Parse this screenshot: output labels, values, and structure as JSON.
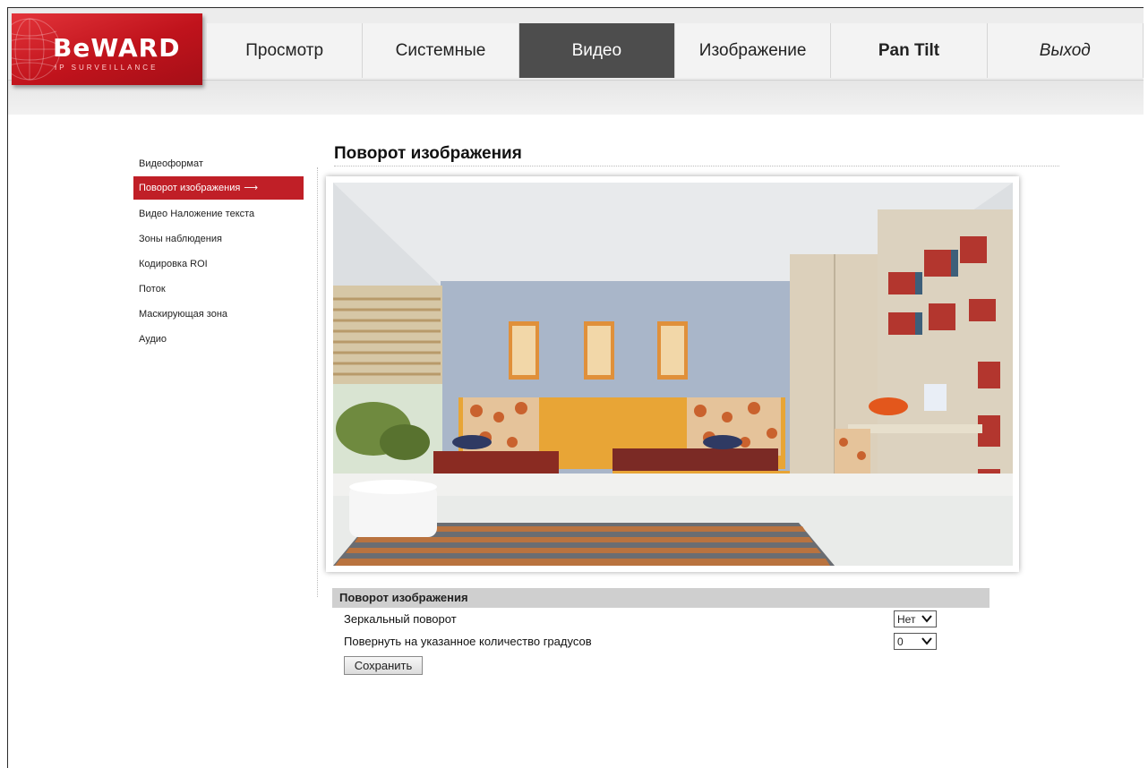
{
  "brand": {
    "name": "BeWARD",
    "tagline": "IP SURVEILLANCE"
  },
  "nav": {
    "tabs": [
      {
        "label": "Просмотр"
      },
      {
        "label": "Системные"
      },
      {
        "label": "Видео"
      },
      {
        "label": "Изображение"
      },
      {
        "label": "Pan Tilt"
      },
      {
        "label": "Выход"
      }
    ],
    "active": "Видео"
  },
  "sidebar": {
    "items": [
      {
        "label": "Видеоформат"
      },
      {
        "label": "Поворот изображения"
      },
      {
        "label": "Видео Наложение текста"
      },
      {
        "label": "Зоны наблюдения"
      },
      {
        "label": "Кодировка ROI"
      },
      {
        "label": "Поток"
      },
      {
        "label": "Маскирующая зона"
      },
      {
        "label": "Аудио"
      }
    ],
    "active_arrow": "⟶"
  },
  "main": {
    "title": "Поворот изображения",
    "preview_icon": "camera-preview-image"
  },
  "settings": {
    "header": "Поворот изображения",
    "mirror": {
      "label": "Зеркальный поворот",
      "value": "Нет"
    },
    "rotate": {
      "label": "Повернуть на указанное количество градусов",
      "value": "0"
    },
    "save_label": "Сохранить"
  },
  "colors": {
    "accent": "#c01f27",
    "active_tab": "#4d4d4d"
  }
}
